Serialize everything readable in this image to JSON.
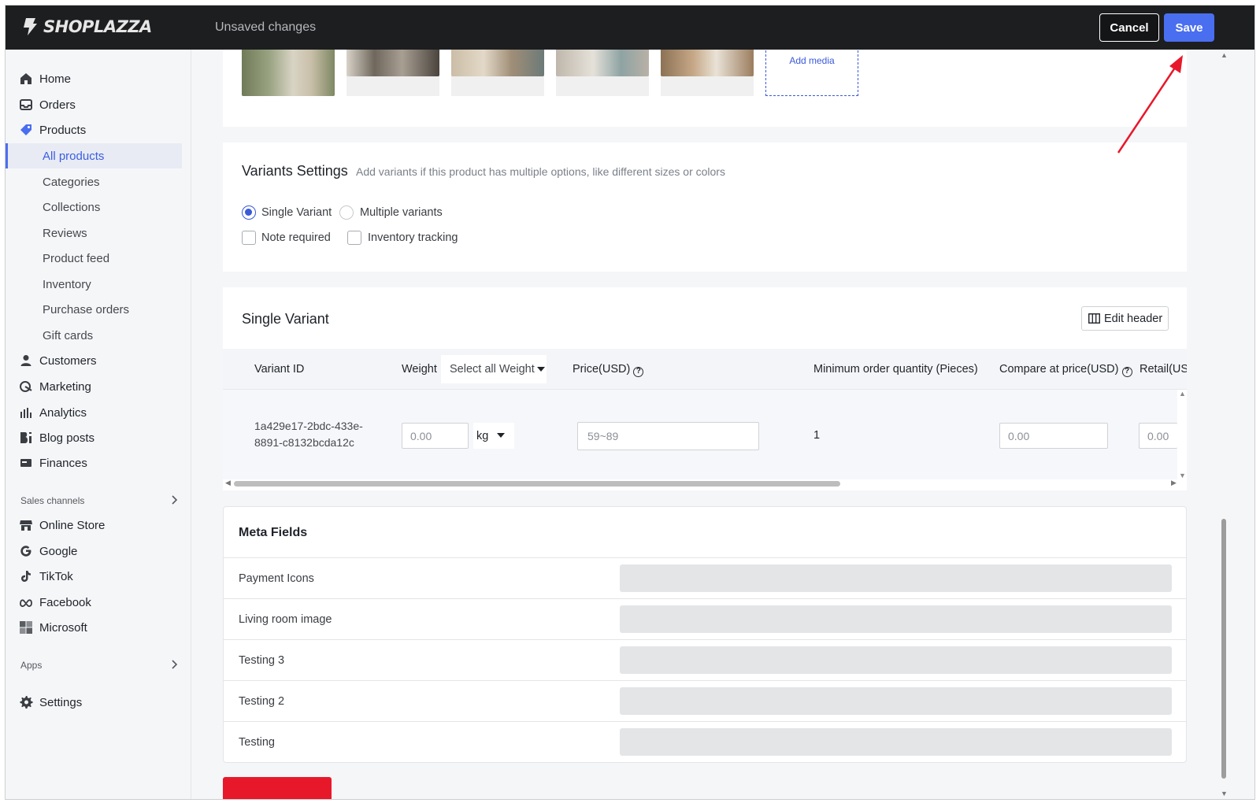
{
  "app": {
    "logo_text": "SHOPLAZZA",
    "status": "Unsaved changes",
    "cancel_label": "Cancel",
    "save_label": "Save"
  },
  "sidebar": {
    "items": [
      {
        "label": "Home",
        "icon": "home-icon"
      },
      {
        "label": "Orders",
        "icon": "inbox-icon"
      },
      {
        "label": "Products",
        "icon": "tag-icon"
      }
    ],
    "product_sub": [
      {
        "label": "All products",
        "active": true
      },
      {
        "label": "Categories"
      },
      {
        "label": "Collections"
      },
      {
        "label": "Reviews"
      },
      {
        "label": "Product feed"
      },
      {
        "label": "Inventory"
      },
      {
        "label": "Purchase orders"
      },
      {
        "label": "Gift cards"
      }
    ],
    "items2": [
      {
        "label": "Customers",
        "icon": "person-icon"
      },
      {
        "label": "Marketing",
        "icon": "marketing-icon"
      },
      {
        "label": "Analytics",
        "icon": "bar-chart-icon"
      },
      {
        "label": "Blog posts",
        "icon": "blog-icon"
      },
      {
        "label": "Finances",
        "icon": "finance-icon"
      }
    ],
    "sales_channels_label": "Sales channels",
    "channels": [
      {
        "label": "Online Store",
        "icon": "store-icon"
      },
      {
        "label": "Google",
        "icon": "google-icon"
      },
      {
        "label": "TikTok",
        "icon": "tiktok-icon"
      },
      {
        "label": "Facebook",
        "icon": "meta-icon"
      },
      {
        "label": "Microsoft",
        "icon": "microsoft-icon"
      }
    ],
    "apps_label": "Apps",
    "settings_label": "Settings"
  },
  "media": {
    "add_media_label": "Add media",
    "thumb_colors": [
      "#8f9a77",
      "#7d7468",
      "#b7a892",
      "#a79e93",
      "#a2866a"
    ]
  },
  "variants_settings": {
    "title": "Variants Settings",
    "subtitle": "Add variants if this product has multiple options, like different sizes or colors",
    "option_single": "Single Variant",
    "option_multiple": "Multiple variants",
    "selected": "Single Variant",
    "note_required": "Note required",
    "inventory_tracking": "Inventory tracking"
  },
  "single_variant": {
    "title": "Single Variant",
    "edit_header_label": "Edit header",
    "columns": {
      "variant_id": "Variant ID",
      "weight": "Weight",
      "weight_select": "Select all Weight",
      "price": "Price(USD)",
      "moq": "Minimum order quantity (Pieces)",
      "compare": "Compare at price(USD)",
      "retail": "Retail(USD"
    },
    "row": {
      "variant_id_line1": "1a429e17-2bdc-433e-",
      "variant_id_line2": "8891-c8132bcda12c",
      "weight_placeholder": "0.00",
      "unit": "kg",
      "price_placeholder": "59~89",
      "moq": "1",
      "compare_placeholder": "0.00",
      "retail_placeholder": "0.00"
    }
  },
  "meta_fields": {
    "title": "Meta Fields",
    "rows": [
      {
        "label": "Payment Icons"
      },
      {
        "label": "Living room image"
      },
      {
        "label": "Testing 3"
      },
      {
        "label": "Testing 2"
      },
      {
        "label": "Testing"
      }
    ]
  },
  "colors": {
    "accent": "#4a6ef0",
    "annotation_arrow": "#e8182b"
  }
}
